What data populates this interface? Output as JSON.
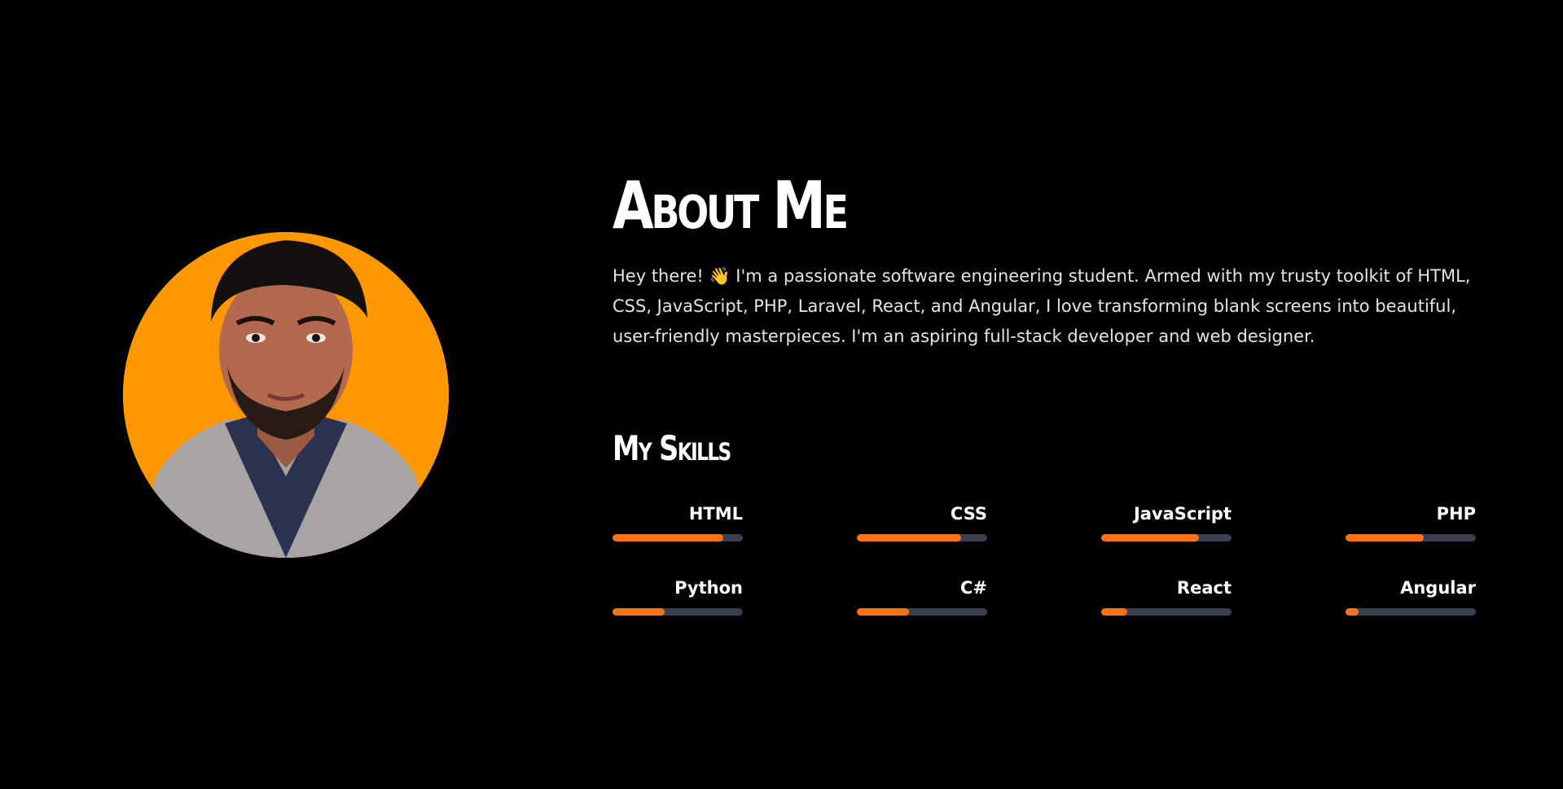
{
  "about": {
    "title": "About Me",
    "bio_before": "Hey there! ",
    "bio_emoji": "👋",
    "bio_after": " I'm a passionate software engineering student. Armed with my trusty toolkit of HTML, CSS, JavaScript, PHP, Laravel, React, and Angular, I love transforming blank screens into beautiful, user-friendly masterpieces. I'm an aspiring full-stack developer and web designer."
  },
  "skills": {
    "title": "My Skills",
    "items": [
      {
        "name": "HTML",
        "level": 0.85
      },
      {
        "name": "CSS",
        "level": 0.8
      },
      {
        "name": "JavaScript",
        "level": 0.75
      },
      {
        "name": "PHP",
        "level": 0.6
      },
      {
        "name": "Python",
        "level": 0.4
      },
      {
        "name": "C#",
        "level": 0.4
      },
      {
        "name": "React",
        "level": 0.2
      },
      {
        "name": "Angular",
        "level": 0.1
      }
    ]
  },
  "colors": {
    "background": "#000000",
    "accent": "#f97316",
    "avatar_background": "#ff9800",
    "track": "#3a4050"
  }
}
